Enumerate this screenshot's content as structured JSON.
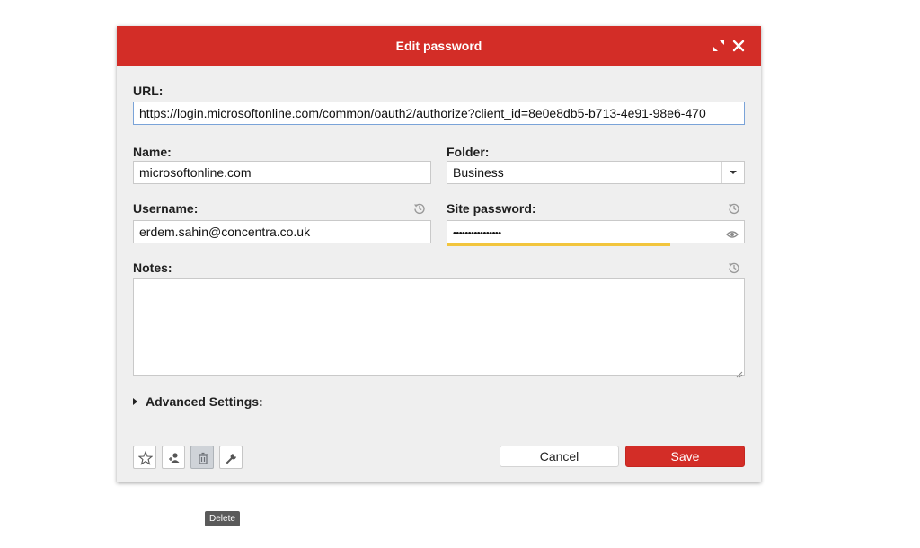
{
  "dialog": {
    "title": "Edit password",
    "accent_color": "#d32d27",
    "expand_icon": "expand-icon",
    "close_icon": "close-icon"
  },
  "form": {
    "url_label": "URL:",
    "url_value": "https://login.microsoftonline.com/common/oauth2/authorize?client_id=8e0e8db5-b713-4e91-98e6-470",
    "name_label": "Name:",
    "name_value": "microsoftonline.com",
    "folder_label": "Folder:",
    "folder_value": "Business",
    "username_label": "Username:",
    "username_value": "erdem.sahin@concentra.co.uk",
    "site_password_label": "Site password:",
    "site_password_value": "••••••••••••••••",
    "password_strength": 0.75,
    "strength_color": "#f2c53d",
    "notes_label": "Notes:",
    "notes_value": "",
    "advanced_label": "Advanced Settings:"
  },
  "footer": {
    "icons": [
      "star-icon",
      "share-user-icon",
      "trash-icon",
      "wrench-icon"
    ],
    "cancel_label": "Cancel",
    "save_label": "Save"
  },
  "tooltip": {
    "text": "Delete"
  }
}
